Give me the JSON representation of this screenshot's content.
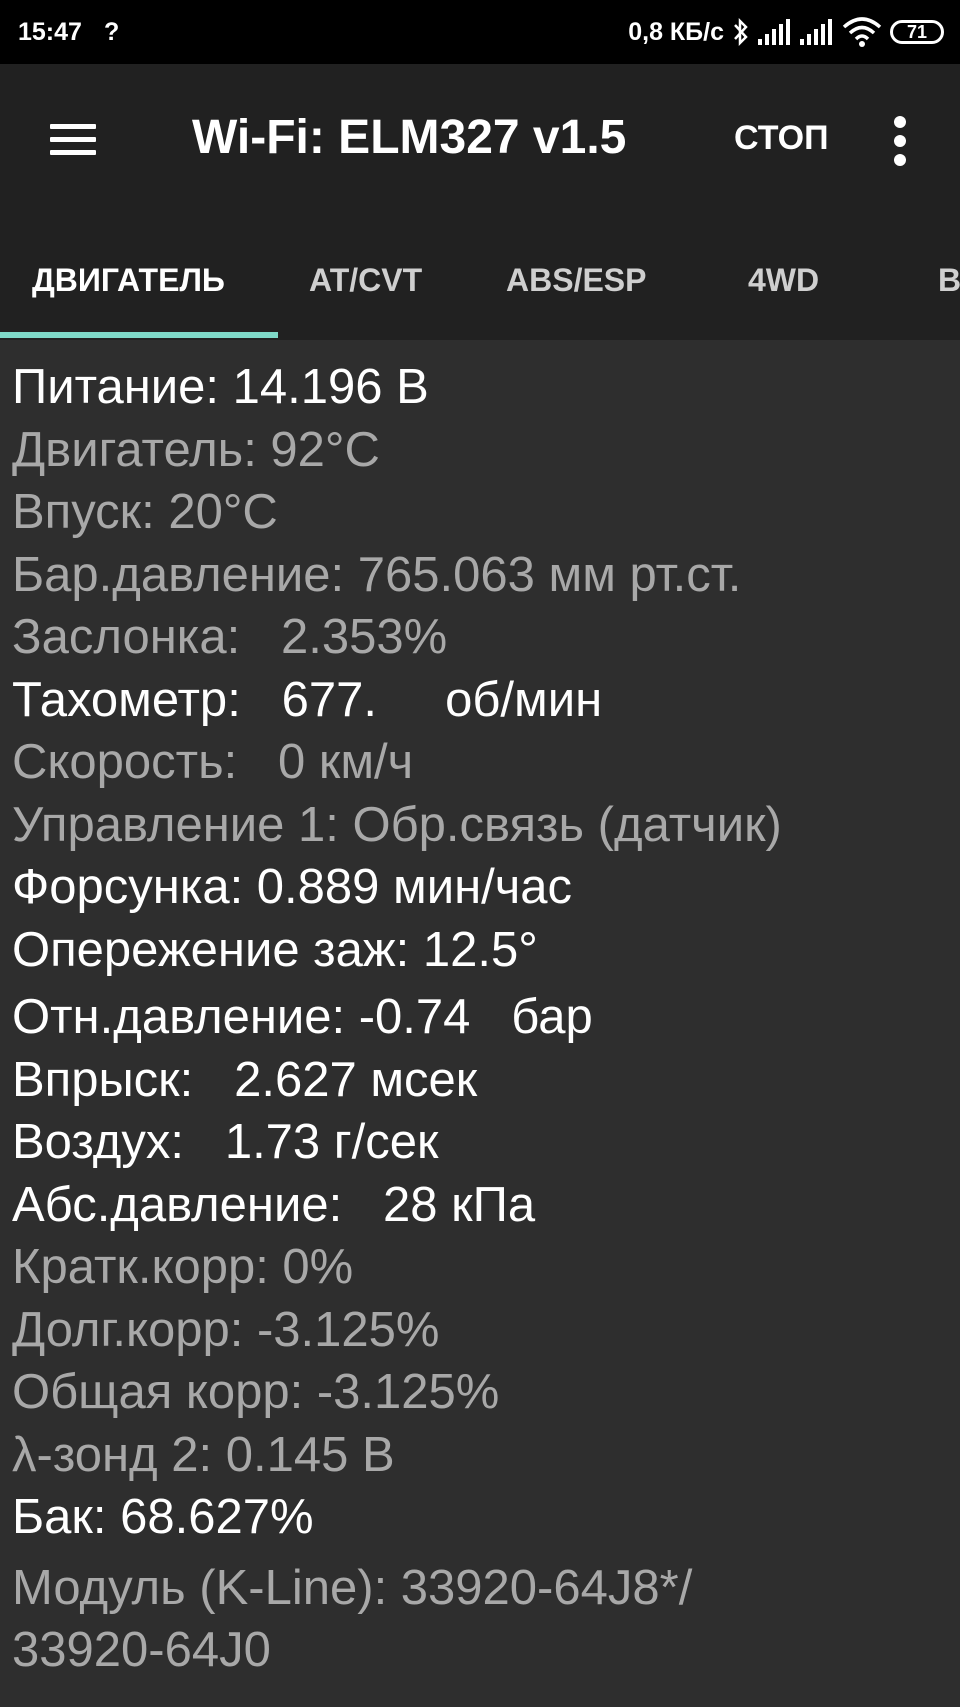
{
  "status_bar": {
    "time": "15:47",
    "unknown_icon": "?",
    "speed": "0,8 КБ/с",
    "battery": "71"
  },
  "app_bar": {
    "title": "Wi-Fi: ELM327 v1.5",
    "stop_label": "СТОП"
  },
  "tabs": [
    {
      "label": "ДВИГАТЕЛЬ",
      "active": true
    },
    {
      "label": "AT/CVT",
      "active": false
    },
    {
      "label": "ABS/ESP",
      "active": false
    },
    {
      "label": "4WD",
      "active": false
    },
    {
      "label": "B",
      "active": false
    }
  ],
  "rows": [
    {
      "text": "Питание: 14.196 В",
      "highlight": true
    },
    {
      "text": "Двигатель: 92°C",
      "highlight": false
    },
    {
      "text": "Впуск: 20°C",
      "highlight": false
    },
    {
      "text": "Бар.давление: 765.063 мм рт.ст.",
      "highlight": false
    },
    {
      "text": "Заслонка:   2.353%",
      "highlight": false
    },
    {
      "text": "Тахометр:   677.     об/мин",
      "highlight": true
    },
    {
      "text": "Скорость:   0 км/ч",
      "highlight": false
    },
    {
      "text": "Управление 1: Обр.связь (датчик)",
      "highlight": false
    },
    {
      "text": "Форсунка: 0.889 мин/час",
      "highlight": true
    },
    {
      "text": "Опережение заж: 12.5°",
      "highlight": true
    },
    {
      "text": "Отн.давление: -0.74   бар",
      "highlight": true
    },
    {
      "text": "Впрыск:   2.627 мсек",
      "highlight": true
    },
    {
      "text": "Воздух:   1.73 г/сек",
      "highlight": true
    },
    {
      "text": "Абс.давление:   28 кПа",
      "highlight": true
    },
    {
      "text": "Кратк.корр: 0%",
      "highlight": false
    },
    {
      "text": "Долг.корр: -3.125%",
      "highlight": false
    },
    {
      "text": "Общая корр: -3.125%",
      "highlight": false
    },
    {
      "text": "λ-зонд 2: 0.145 В",
      "highlight": false
    },
    {
      "text": "Бак: 68.627%",
      "highlight": true
    },
    {
      "text": "Модуль (K-Line): 33920-64J8*/",
      "highlight": false
    },
    {
      "text": "33920-64J0",
      "highlight": false
    }
  ],
  "colors": {
    "background": "#2e2e2e",
    "app_bar": "#212121",
    "tab_indicator": "#7fd9c8",
    "text_highlight": "#ffffff",
    "text_dim": "#a8a8a8"
  }
}
